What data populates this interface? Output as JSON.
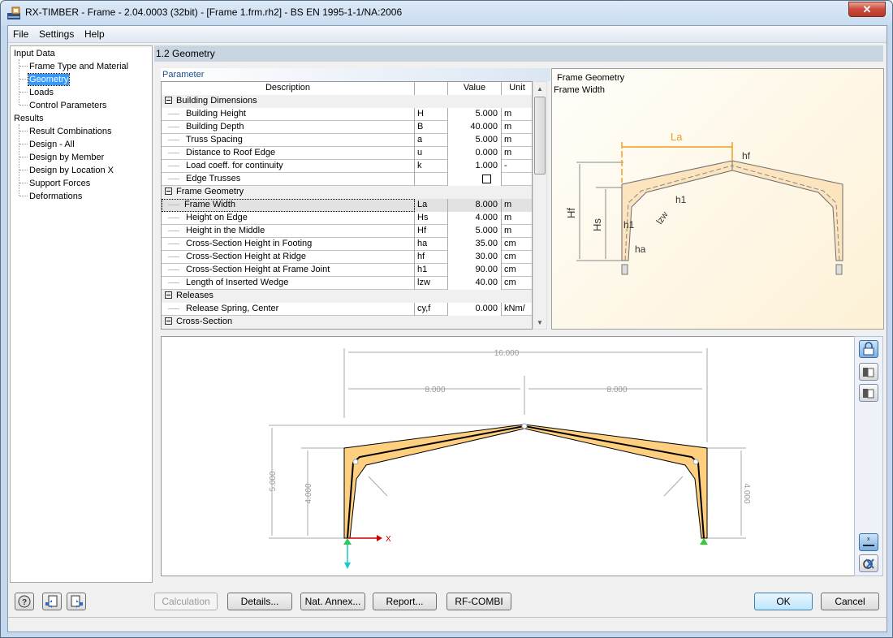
{
  "window": {
    "title": "RX-TIMBER - Frame - 2.04.0003 (32bit) - [Frame 1.frm.rh2] - BS EN 1995-1-1/NA:2006",
    "close_label": "✕"
  },
  "menu": [
    "File",
    "Settings",
    "Help"
  ],
  "nav": {
    "groups": [
      {
        "label": "Input Data",
        "items": [
          "Frame Type and Material",
          "Geometry",
          "Loads",
          "Control Parameters"
        ]
      },
      {
        "label": "Results",
        "items": [
          "Result Combinations",
          "Design - All",
          "Design by Member",
          "Design by Location X",
          "Support Forces",
          "Deformations"
        ]
      }
    ],
    "selected": "Geometry"
  },
  "section": {
    "title": "1.2 Geometry"
  },
  "params": {
    "title": "Parameter",
    "headers": {
      "description": "Description",
      "symbol": "",
      "value": "Value",
      "unit": "Unit"
    },
    "groups": [
      {
        "label": "Building Dimensions",
        "rows": [
          {
            "desc": "Building Height",
            "sym": "H",
            "value": "5.000",
            "unit": "m"
          },
          {
            "desc": "Building Depth",
            "sym": "B",
            "value": "40.000",
            "unit": "m"
          },
          {
            "desc": "Truss Spacing",
            "sym": "a",
            "value": "5.000",
            "unit": "m"
          },
          {
            "desc": "Distance to Roof Edge",
            "sym": "u",
            "value": "0.000",
            "unit": "m"
          },
          {
            "desc": "Load coeff. for continuity",
            "sym": "k",
            "value": "1.000",
            "unit": "-"
          },
          {
            "desc": "Edge Trusses",
            "sym": "",
            "value": "",
            "unit": "",
            "checkbox": false
          }
        ]
      },
      {
        "label": "Frame Geometry",
        "rows": [
          {
            "desc": "Frame Width",
            "sym": "La",
            "value": "8.000",
            "unit": "m",
            "selected": true
          },
          {
            "desc": "Height on Edge",
            "sym": "Hs",
            "value": "4.000",
            "unit": "m"
          },
          {
            "desc": "Height in the Middle",
            "sym": "Hf",
            "value": "5.000",
            "unit": "m"
          },
          {
            "desc": "Cross-Section Height in Footing",
            "sym": "ha",
            "value": "35.00",
            "unit": "cm"
          },
          {
            "desc": "Cross-Section Height at Ridge",
            "sym": "hf",
            "value": "30.00",
            "unit": "cm"
          },
          {
            "desc": "Cross-Section Height at Frame Joint",
            "sym": "h1",
            "value": "90.00",
            "unit": "cm"
          },
          {
            "desc": "Length of Inserted Wedge",
            "sym": "lzw",
            "value": "40.00",
            "unit": "cm"
          }
        ]
      },
      {
        "label": "Releases",
        "rows": [
          {
            "desc": "Release Spring, Center",
            "sym": "cy,f",
            "value": "0.000",
            "unit": "kNm/"
          }
        ]
      },
      {
        "label": "Cross-Section",
        "rows": []
      }
    ]
  },
  "figure": {
    "title": "Frame Geometry",
    "subtitle": "Frame Width",
    "labels": {
      "La": "La",
      "hf": "hf",
      "h1": "h1",
      "h1b": "h1",
      "Hf": "Hf",
      "Hs": "Hs",
      "ha": "ha",
      "lzw": "lzw"
    }
  },
  "graphic": {
    "dim_total": "16.000",
    "dim_left": "8.000",
    "dim_right": "8.000",
    "dim_height_mid": "5.000",
    "dim_height_edge_left": "4.000",
    "dim_height_edge_right": "4.000",
    "axis_x": "X"
  },
  "toolbar": {
    "buttons": [
      "lock",
      "export-table",
      "import-table",
      "dimension-toggle",
      "view-reset"
    ]
  },
  "buttons": {
    "calculation": "Calculation",
    "details": "Details...",
    "nat_annex": "Nat. Annex...",
    "report": "Report...",
    "rf_combi": "RF-COMBI",
    "ok": "OK",
    "cancel": "Cancel"
  },
  "colors": {
    "timber_fill": "#fdcf7f",
    "selection": "#3399ff",
    "la_dim": "#f39c1f"
  }
}
